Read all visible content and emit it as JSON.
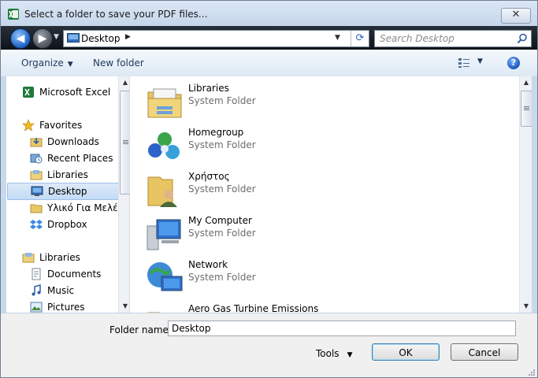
{
  "window": {
    "title": "Select a folder to save your PDF files...",
    "close_label": "✕"
  },
  "nav": {
    "back_label": "◀",
    "forward_label": "▶",
    "history_caret": "▼",
    "address": {
      "text": "Desktop",
      "chevron": "▶",
      "dropdown": "▼",
      "refresh": "⟳"
    },
    "search": {
      "placeholder": "Search Desktop"
    }
  },
  "toolbar": {
    "organize_label": "Organize",
    "organize_caret": "▼",
    "new_folder_label": "New folder",
    "views_caret": "▼",
    "help_label": "?"
  },
  "sidebar": {
    "items": [
      {
        "label": "Microsoft Excel",
        "icon": "excel-icon"
      },
      {
        "label": "Favorites",
        "icon": "star-icon"
      },
      {
        "label": "Downloads",
        "icon": "downloads-folder-icon"
      },
      {
        "label": "Recent Places",
        "icon": "recent-places-icon"
      },
      {
        "label": "Libraries",
        "icon": "libraries-icon"
      },
      {
        "label": "Desktop",
        "icon": "desktop-icon",
        "selected": true
      },
      {
        "label": "Υλικό Για Μελέτη",
        "icon": "folder-icon"
      },
      {
        "label": "Dropbox",
        "icon": "dropbox-icon"
      },
      {
        "label": "Libraries",
        "icon": "libraries-icon"
      },
      {
        "label": "Documents",
        "icon": "documents-icon"
      },
      {
        "label": "Music",
        "icon": "music-icon"
      },
      {
        "label": "Pictures",
        "icon": "pictures-icon"
      }
    ]
  },
  "files": [
    {
      "name": "Libraries",
      "type": "System Folder",
      "icon": "libraries-folder-icon"
    },
    {
      "name": "Homegroup",
      "type": "System Folder",
      "icon": "homegroup-icon"
    },
    {
      "name": "Χρήστος",
      "type": "System Folder",
      "icon": "user-folder-icon"
    },
    {
      "name": "My Computer",
      "type": "System Folder",
      "icon": "computer-icon"
    },
    {
      "name": "Network",
      "type": "System Folder",
      "icon": "network-icon"
    },
    {
      "name": "Aero Gas Turbine Emissions",
      "type": "",
      "icon": "folder-icon"
    }
  ],
  "bottom": {
    "folder_name_label": "Folder name:",
    "folder_name_value": "Desktop",
    "tools_label": "Tools",
    "tools_caret": "▼",
    "ok_label": "OK",
    "cancel_label": "Cancel"
  },
  "scroll": {
    "up": "▲",
    "down": "▼"
  },
  "colors": {
    "accent": "#1e395b",
    "selection": "#c4dbf5",
    "title_bg": "#c5d6ea",
    "nav_bg": "#1a1f27"
  }
}
